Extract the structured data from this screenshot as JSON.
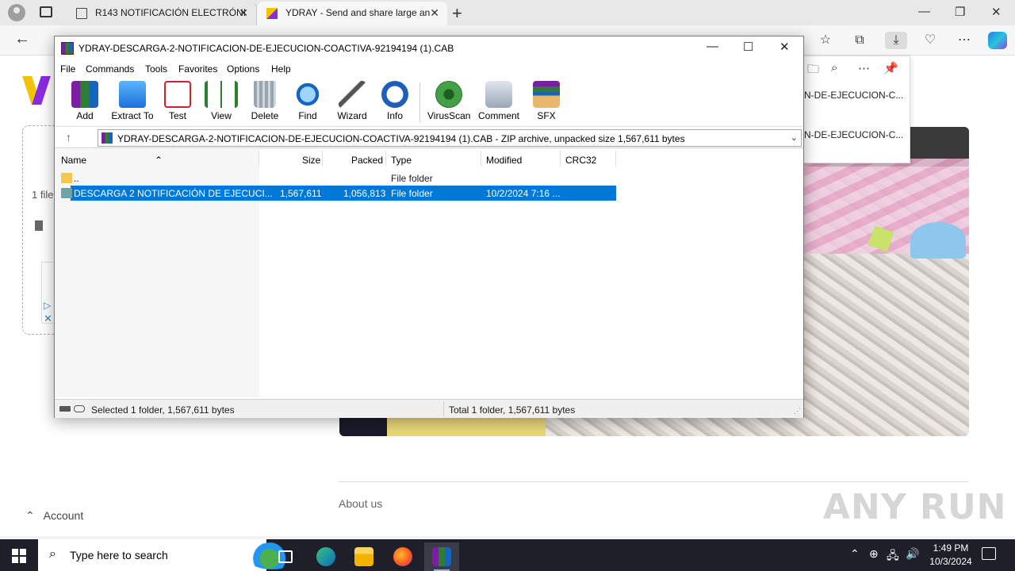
{
  "browser": {
    "tabs": [
      {
        "title": "R143 NOTIFICACIÓN ELECTRÓNI",
        "active": false
      },
      {
        "title": "YDRAY - Send and share large an",
        "active": true
      }
    ],
    "download_panel": {
      "row1": "N-DE-EJECUCION-C...",
      "row2": "N-DE-EJECUCION-C..."
    }
  },
  "page": {
    "files_count": "1 file",
    "account_label": "Account",
    "about_us": "About us",
    "watermark": "ANY RUN"
  },
  "winrar": {
    "title": "YDRAY-DESCARGA-2-NOTIFICACION-DE-EJECUCION-COACTIVA-92194194 (1).CAB",
    "menu": [
      "File",
      "Commands",
      "Tools",
      "Favorites",
      "Options",
      "Help"
    ],
    "toolbar": [
      "Add",
      "Extract To",
      "Test",
      "View",
      "Delete",
      "Find",
      "Wizard",
      "Info",
      "VirusScan",
      "Comment",
      "SFX"
    ],
    "path": "YDRAY-DESCARGA-2-NOTIFICACION-DE-EJECUCION-COACTIVA-92194194 (1).CAB - ZIP archive, unpacked size 1,567,611 bytes",
    "columns": {
      "name": "Name",
      "size": "Size",
      "packed": "Packed",
      "type": "Type",
      "modified": "Modified",
      "crc": "CRC32"
    },
    "rows": [
      {
        "name": "..",
        "size": "",
        "packed": "",
        "type": "File folder",
        "modified": "",
        "crc": ""
      },
      {
        "name": "DESCARGA 2  NOTIFICACIÓN DE EJECUCI...",
        "size": "1,567,611",
        "packed": "1,056,813",
        "type": "File folder",
        "modified": "10/2/2024 7:16 ...",
        "crc": ""
      }
    ],
    "status_left": "Selected 1 folder, 1,567,611 bytes",
    "status_right": "Total 1 folder, 1,567,611 bytes"
  },
  "taskbar": {
    "search_placeholder": "Type here to search",
    "time": "1:49 PM",
    "date": "10/3/2024"
  },
  "colors": {
    "selection": "#0078d7",
    "taskbar": "#1f1f2a"
  }
}
